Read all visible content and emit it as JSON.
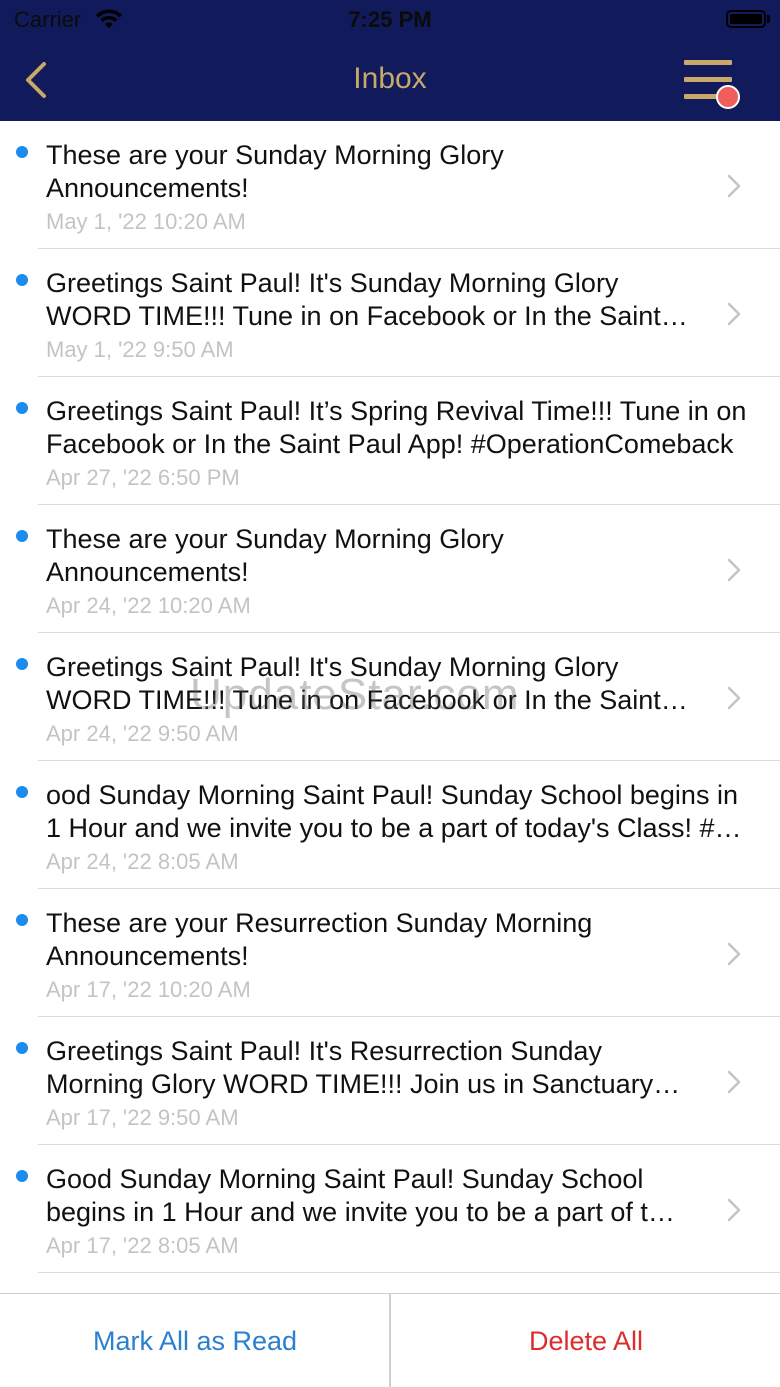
{
  "status_bar": {
    "carrier": "Carrier",
    "time": "7:25 PM"
  },
  "header": {
    "title": "Inbox",
    "accent_color": "#c9a86a",
    "background_color": "#111a5a"
  },
  "watermark": "UpdateStar.com",
  "messages": [
    {
      "lines": [
        "These are your Sunday Morning Glory",
        "Announcements!"
      ],
      "date": "May 1, '22 10:20 AM",
      "unread": true
    },
    {
      "lines": [
        "Greetings Saint Paul! It's Sunday Morning Glory",
        "WORD TIME!!! Tune in on Facebook or In the Saint…"
      ],
      "date": "May 1, '22 9:50 AM",
      "unread": true
    },
    {
      "lines": [
        "Greetings Saint Paul! It’s Spring Revival Time!!! Tune in on",
        "Facebook or In the Saint Paul App! #OperationComeback"
      ],
      "date": "Apr 27, '22 6:50 PM",
      "unread": true
    },
    {
      "lines": [
        "These are your Sunday Morning Glory",
        "Announcements!"
      ],
      "date": "Apr 24, '22 10:20 AM",
      "unread": true
    },
    {
      "lines": [
        "Greetings Saint Paul! It's Sunday Morning Glory",
        "WORD TIME!!! Tune in on Facebook or In the Saint…"
      ],
      "date": "Apr 24, '22 9:50 AM",
      "unread": true
    },
    {
      "lines": [
        "ood Sunday Morning Saint Paul! Sunday School begins in",
        "1 Hour and we invite you to be a part of today's Class! #…"
      ],
      "date": "Apr 24, '22 8:05 AM",
      "unread": true
    },
    {
      "lines": [
        "These are your Resurrection Sunday Morning",
        "Announcements!"
      ],
      "date": "Apr 17, '22 10:20 AM",
      "unread": true
    },
    {
      "lines": [
        "Greetings Saint Paul! It's Resurrection Sunday",
        "Morning Glory WORD TIME!!! Join us in Sanctuary…"
      ],
      "date": "Apr 17, '22 9:50 AM",
      "unread": true
    },
    {
      "lines": [
        "Good Sunday Morning Saint Paul! Sunday School",
        "begins in 1 Hour and we invite you to be a part of t…"
      ],
      "date": "Apr 17, '22 8:05 AM",
      "unread": true
    }
  ],
  "footer": {
    "mark_all_label": "Mark All as Read",
    "delete_all_label": "Delete All"
  }
}
